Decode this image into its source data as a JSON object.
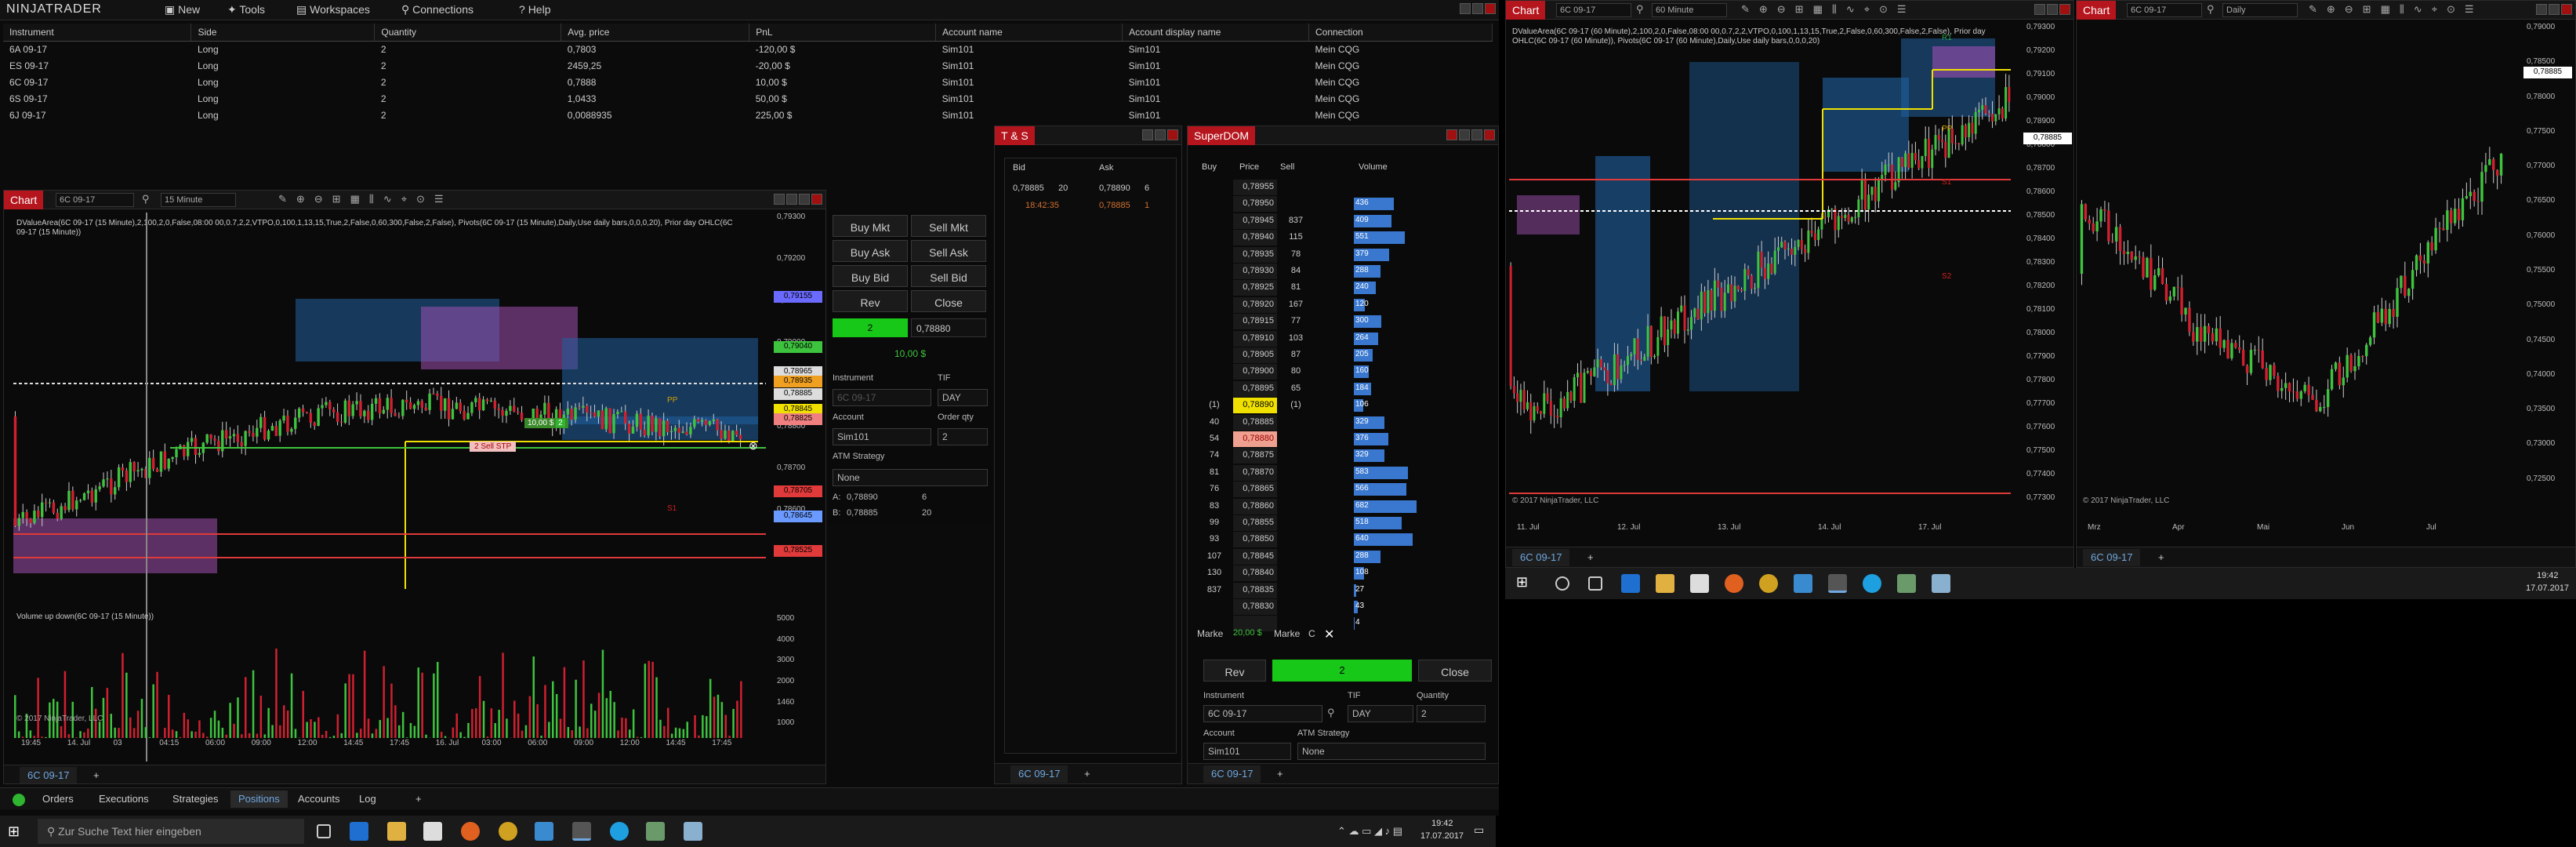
{
  "app": {
    "logo": "NINJATRADER"
  },
  "menu": {
    "new": "New",
    "tools": "Tools",
    "workspaces": "Workspaces",
    "connections": "Connections",
    "help": "Help"
  },
  "positions": {
    "columns": [
      "Instrument",
      "Side",
      "Quantity",
      "Avg. price",
      "PnL",
      "Account name",
      "Account display name",
      "Connection"
    ],
    "rows": [
      [
        "6A 09-17",
        "Long",
        "2",
        "0,7803",
        "-120,00 $",
        "Sim101",
        "Sim101",
        "Mein CQG"
      ],
      [
        "ES 09-17",
        "Long",
        "2",
        "2459,25",
        "-20,00 $",
        "Sim101",
        "Sim101",
        "Mein CQG"
      ],
      [
        "6C 09-17",
        "Long",
        "2",
        "0,7888",
        "10,00 $",
        "Sim101",
        "Sim101",
        "Mein CQG"
      ],
      [
        "6S 09-17",
        "Long",
        "2",
        "1,0433",
        "50,00 $",
        "Sim101",
        "Sim101",
        "Mein CQG"
      ],
      [
        "6J 09-17",
        "Long",
        "2",
        "0,0088935",
        "225,00 $",
        "Sim101",
        "Sim101",
        "Mein CQG"
      ]
    ]
  },
  "chart1": {
    "tab": "Chart",
    "instrument": "6C 09-17",
    "interval": "15 Minute",
    "header": "DValueArea(6C 09-17 (15 Minute),2,100,2,0,False,08:00 00,0.7,2,2,VTPO,0,100,1,13,15,True,2,False,0,60,300,False,2,False), Pivots(6C 09-17 (15 Minute),Daily,Use daily bars,0,0,0,20), Prior day OHLC(6C",
    "header2": "09-17 (15 Minute))",
    "yaxis": [
      "0,79300",
      "0,79200",
      "0,79100",
      "0,79000",
      "0,78900",
      "0,78800",
      "0,78700",
      "0,78600",
      "0,78500"
    ],
    "tags": [
      "0,79155",
      "0,79040",
      "0,78965",
      "0,78935",
      "0,78885",
      "0,78845",
      "0,78825",
      "0,78705",
      "0,78645",
      "0,78525"
    ],
    "xaxis": [
      "19:45",
      "14. Jul",
      "03",
      "04:15",
      "06:00",
      "09:00",
      "12:00",
      "14:45",
      "17:45",
      "16. Jul",
      "03:00",
      "06:00",
      "09:00",
      "12:00",
      "14:45",
      "17:45"
    ],
    "volume_title": "Volume up down(6C 09-17 (15 Minute))",
    "vol_axis": [
      "5000",
      "4000",
      "3000",
      "2000",
      "1460",
      "1000"
    ],
    "copyright": "© 2017 NinjaTrader, LLC",
    "tab_bottom": "6C 09-17",
    "pnl_flag": "10,00 $",
    "qty_flag": "2",
    "order_flag": "2 Sell STP",
    "pp": "PP",
    "s1": "S1"
  },
  "order_panel": {
    "buy_mkt": "Buy Mkt",
    "sell_mkt": "Sell Mkt",
    "buy_ask": "Buy Ask",
    "sell_ask": "Sell Ask",
    "buy_bid": "Buy Bid",
    "sell_bid": "Sell Bid",
    "rev": "Rev",
    "close": "Close",
    "pos_qty": "2",
    "pos_price": "0,78880",
    "pos_pnl": "10,00 $",
    "instrument_label": "Instrument",
    "instrument": "6C 09-17",
    "tif_label": "TIF",
    "tif": "DAY",
    "account_label": "Account",
    "account": "Sim101",
    "qty_label": "Order qty",
    "qty": "2",
    "atm_label": "ATM Strategy",
    "atm": "None",
    "a_label": "A:",
    "a_price": "0,78890",
    "a_size": "6",
    "b_label": "B:",
    "b_price": "0,78885",
    "b_size": "20"
  },
  "ts": {
    "title": "T & S",
    "bid": "Bid",
    "ask": "Ask",
    "row1": {
      "bid": "0,78885",
      "bsize": "20",
      "ask": "0,78890",
      "asize": "6"
    },
    "row2": {
      "time": "18:42:35",
      "price": "0,78885",
      "size": "1"
    },
    "tab": "6C 09-17"
  },
  "superdom": {
    "title": "SuperDOM",
    "buy": "Buy",
    "price": "Price",
    "sell": "Sell",
    "volume": "Volume",
    "rows": [
      [
        "",
        "0,78955",
        "",
        "",
        ""
      ],
      [
        "",
        "0,78950",
        "",
        "",
        "436"
      ],
      [
        "",
        "0,78945",
        "837",
        "",
        "409"
      ],
      [
        "",
        "0,78940",
        "115",
        "",
        "551"
      ],
      [
        "",
        "0,78935",
        "78",
        "",
        "379"
      ],
      [
        "",
        "0,78930",
        "84",
        "",
        "288"
      ],
      [
        "",
        "0,78925",
        "81",
        "",
        "240"
      ],
      [
        "",
        "0,78920",
        "167",
        "",
        "120"
      ],
      [
        "",
        "0,78915",
        "77",
        "",
        "300"
      ],
      [
        "",
        "0,78910",
        "103",
        "",
        "264"
      ],
      [
        "",
        "0,78905",
        "87",
        "",
        "205"
      ],
      [
        "",
        "0,78900",
        "80",
        "",
        "160"
      ],
      [
        "",
        "0,78895",
        "65",
        "",
        "184"
      ],
      [
        "(1)",
        "0,78890",
        "(1)",
        "",
        "106"
      ],
      [
        "40",
        "0,78885",
        "",
        "",
        "329"
      ],
      [
        "54",
        "0,78880",
        "",
        "",
        "376"
      ],
      [
        "74",
        "0,78875",
        "",
        "",
        "329"
      ],
      [
        "81",
        "0,78870",
        "",
        "",
        "583"
      ],
      [
        "76",
        "0,78865",
        "",
        "",
        "566"
      ],
      [
        "83",
        "0,78860",
        "",
        "",
        "682"
      ],
      [
        "99",
        "0,78855",
        "",
        "",
        "518"
      ],
      [
        "93",
        "0,78850",
        "",
        "",
        "640"
      ],
      [
        "107",
        "0,78845",
        "",
        "",
        "288"
      ],
      [
        "130",
        "0,78840",
        "",
        "",
        "108"
      ],
      [
        "837",
        "0,78835",
        "",
        "",
        "27"
      ],
      [
        "",
        "0,78830",
        "",
        "",
        "43"
      ],
      [
        "",
        "",
        "",
        "",
        "4"
      ]
    ],
    "market": "Marke",
    "pnl": "20,00 $",
    "market2": "Marke",
    "c": "C",
    "rev": "Rev",
    "qty": "2",
    "close": "Close",
    "instrument_label": "Instrument",
    "tif_label": "TIF",
    "quantity_label": "Quantity",
    "instrument": "6C 09-17",
    "tif": "DAY",
    "quantity": "2",
    "account_label": "Account",
    "atm_label": "ATM Strategy",
    "account": "Sim101",
    "atm": "None",
    "tab": "6C 09-17"
  },
  "chart2": {
    "tab": "Chart",
    "instrument": "6C 09-17",
    "interval": "60 Minute",
    "header": "DValueArea(6C 09-17 (60 Minute),2,100,2,0,False,08:00 00,0.7,2,2,VTPO,0,100,1,13,15,True,2,False,0,60,300,False,2,False), Prior day",
    "header2": "OHLC(6C 09-17 (60 Minute)), Pivots(6C 09-17 (60 Minute),Daily,Use daily bars,0,0,0,20)",
    "yaxis": [
      "0,79300",
      "0,79200",
      "0,79100",
      "0,79000",
      "0,78900",
      "0,78800",
      "0,78700",
      "0,78600",
      "0,78500",
      "0,78400",
      "0,78300",
      "0,78200",
      "0,78100",
      "0,78000",
      "0,77900",
      "0,77800",
      "0,77700",
      "0,77600",
      "0,77500",
      "0,77400",
      "0,77300"
    ],
    "tag": "0,78885",
    "xaxis": [
      "11. Jul",
      "12. Jul",
      "13. Jul",
      "14. Jul",
      "17. Jul"
    ],
    "copyright": "© 2017 NinjaTrader, LLC",
    "tab_bottom": "6C 09-17",
    "pp": "PP",
    "r1": "R1",
    "s1": "S1",
    "s2": "S2"
  },
  "chart3": {
    "tab": "Chart",
    "instrument": "6C 09-17",
    "interval": "Daily",
    "yaxis": [
      "0,79000",
      "0,78500",
      "0,78000",
      "0,77500",
      "0,77000",
      "0,76500",
      "0,76000",
      "0,75500",
      "0,75000",
      "0,74500",
      "0,74000",
      "0,73500",
      "0,73000",
      "0,72500"
    ],
    "tag": "0,78885",
    "xaxis": [
      "Mrz",
      "Apr",
      "Mai",
      "Jun",
      "Jul"
    ],
    "copyright": "© 2017 NinjaTrader, LLC",
    "tab_bottom": "6C 09-17"
  },
  "control_tabs": [
    "Orders",
    "Executions",
    "Strategies",
    "Positions",
    "Accounts",
    "Log"
  ],
  "taskbar_left": {
    "search": "Zur Suche Text hier eingeben",
    "time": "19:42",
    "date": "17.07.2017"
  },
  "taskbar_right": {
    "time": "19:42",
    "date": "17.07.2017"
  }
}
